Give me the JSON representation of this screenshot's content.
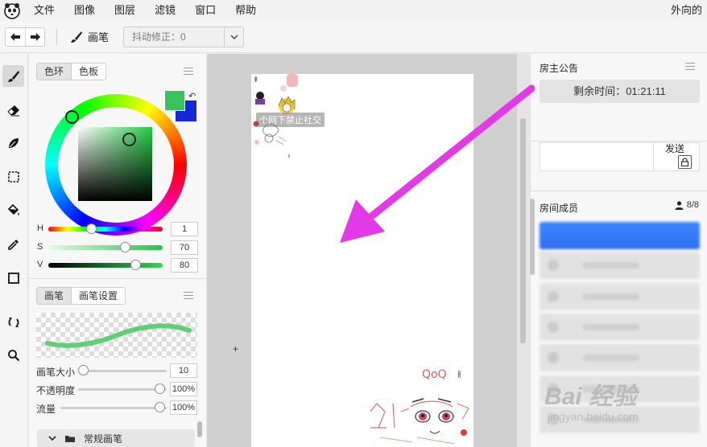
{
  "menubar": {
    "items": [
      "文件",
      "图像",
      "图层",
      "滤镜",
      "窗口",
      "帮助"
    ],
    "right_text": "外向的"
  },
  "toolbar": {
    "brush_label": "画笔",
    "stabilizer_label": "抖动修正：0"
  },
  "tools": [
    "brush-icon",
    "eraser-icon",
    "leaf-brush-icon",
    "marquee-select-icon",
    "fill-bucket-icon",
    "eyedropper-icon",
    "rectangle-icon",
    "rotate-icon",
    "zoom-icon"
  ],
  "color_panel": {
    "tabs": [
      "色环",
      "色板"
    ],
    "foreground_color": "#3cc25a",
    "background_color": "#1428d8",
    "sliders": [
      {
        "label": "H",
        "value": "1"
      },
      {
        "label": "S",
        "value": "70"
      },
      {
        "label": "V",
        "value": "80"
      }
    ]
  },
  "brush_panel": {
    "tabs": [
      "画笔",
      "画笔设置"
    ],
    "properties": [
      {
        "label": "画笔大小",
        "value": "10"
      },
      {
        "label": "不透明度",
        "value": "100%"
      },
      {
        "label": "流量",
        "value": "100%"
      }
    ],
    "category_label": "常规画笔"
  },
  "canvas": {
    "overlay_tag": "个网下禁止社交"
  },
  "room_notice": {
    "title": "房主公告",
    "timer_label": "剩余时间：",
    "timer_value": "01:21:11"
  },
  "chat": {
    "send_label": "发送"
  },
  "members": {
    "title": "房间成员",
    "count": "8/8"
  },
  "watermark": {
    "main": "Bai 经验",
    "sub": "jingyan.baidu.com"
  },
  "colors": {
    "arrow": "#e23ae6",
    "selected_member": "#3b86ff"
  }
}
